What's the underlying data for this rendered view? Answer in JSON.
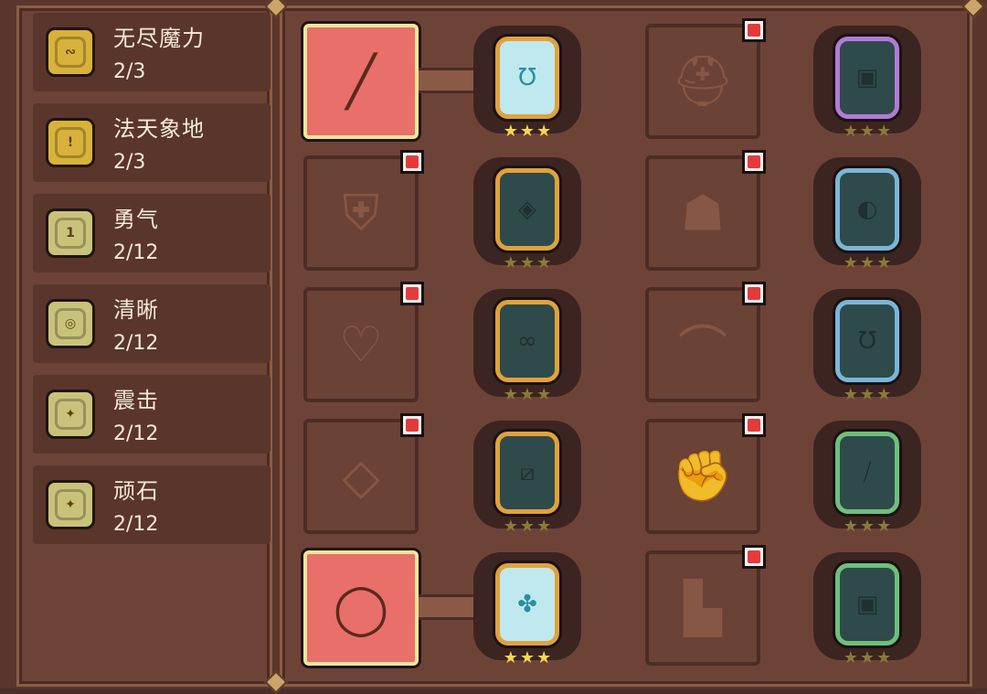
{
  "sets": [
    {
      "name": "无尽魔力",
      "count": "2/3",
      "coin_color": "#d8b23a",
      "icon": "rune-coin-icon",
      "glyph": "∾"
    },
    {
      "name": "法天象地",
      "count": "2/3",
      "coin_color": "#d8b23a",
      "icon": "rune-coin-icon",
      "glyph": "!"
    },
    {
      "name": "勇气",
      "count": "2/12",
      "coin_color": "#c9c27a",
      "icon": "rune-coin-icon",
      "glyph": "1"
    },
    {
      "name": "清晰",
      "count": "2/12",
      "coin_color": "#c9c27a",
      "icon": "rune-coin-icon",
      "glyph": "◎"
    },
    {
      "name": "震击",
      "count": "2/12",
      "coin_color": "#c9c27a",
      "icon": "rune-coin-icon",
      "glyph": "✦"
    },
    {
      "name": "顽石",
      "count": "2/12",
      "coin_color": "#c9c27a",
      "icon": "rune-coin-icon",
      "glyph": "✦"
    }
  ],
  "equipment": [
    {
      "slot": "weapon",
      "icon": "wand-icon",
      "glyph": "╱",
      "active": true,
      "notify": false,
      "gem_color": "#e0a23c",
      "gem_lit": true,
      "gem_glyph": "Ʊ",
      "stars_lit": true
    },
    {
      "slot": "helmet",
      "icon": "helmet-icon",
      "glyph": "⛑",
      "active": false,
      "notify": true,
      "gem_color": "#b27ad8",
      "gem_lit": false,
      "gem_glyph": "▣",
      "stars_lit": false
    },
    {
      "slot": "shield",
      "icon": "shield-icon",
      "glyph": "⛨",
      "active": false,
      "notify": true,
      "gem_color": "#e0a23c",
      "gem_lit": false,
      "gem_glyph": "◈",
      "stars_lit": false
    },
    {
      "slot": "armor",
      "icon": "armor-icon",
      "glyph": "☗",
      "active": false,
      "notify": true,
      "gem_color": "#7ab6d8",
      "gem_lit": false,
      "gem_glyph": "◐",
      "stars_lit": false
    },
    {
      "slot": "necklace",
      "icon": "necklace-icon",
      "glyph": "♡",
      "active": false,
      "notify": true,
      "gem_color": "#e0a23c",
      "gem_lit": false,
      "gem_glyph": "∞",
      "stars_lit": false
    },
    {
      "slot": "cloak",
      "icon": "cloak-icon",
      "glyph": "⌒",
      "active": false,
      "notify": true,
      "gem_color": "#7ab6d8",
      "gem_lit": false,
      "gem_glyph": "Ʊ",
      "stars_lit": false
    },
    {
      "slot": "amulet",
      "icon": "amulet-icon",
      "glyph": "◇",
      "active": false,
      "notify": true,
      "gem_color": "#e0a23c",
      "gem_lit": false,
      "gem_glyph": "⧄",
      "stars_lit": false
    },
    {
      "slot": "gloves",
      "icon": "gloves-icon",
      "glyph": "✊",
      "active": false,
      "notify": true,
      "gem_color": "#6ec07a",
      "gem_lit": false,
      "gem_glyph": "⧸",
      "stars_lit": false
    },
    {
      "slot": "ring",
      "icon": "ring-icon",
      "glyph": "◯",
      "active": true,
      "notify": false,
      "gem_color": "#e0a23c",
      "gem_lit": true,
      "gem_glyph": "✤",
      "stars_lit": true
    },
    {
      "slot": "boots",
      "icon": "boots-icon",
      "glyph": "▙",
      "active": false,
      "notify": true,
      "gem_color": "#6ec07a",
      "gem_lit": false,
      "gem_glyph": "▣",
      "stars_lit": false
    }
  ],
  "star_glyph": "★"
}
